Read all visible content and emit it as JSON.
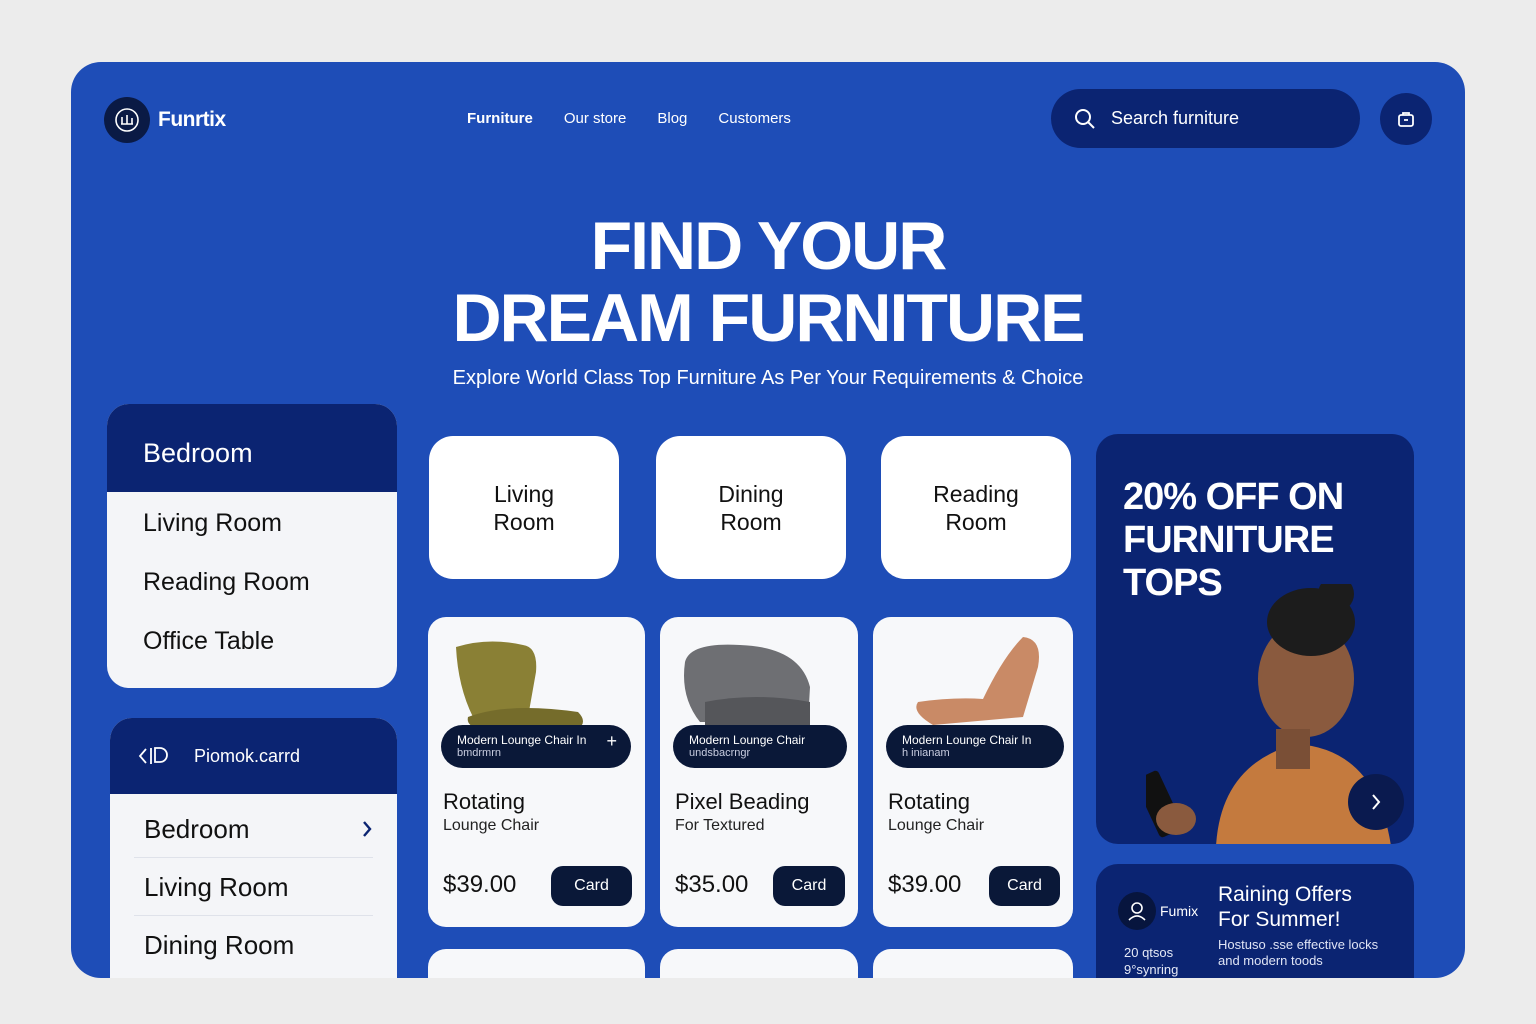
{
  "brand": {
    "name": "Funrtix"
  },
  "nav": [
    "Furniture",
    "Our store",
    "Blog",
    "Customers"
  ],
  "search": {
    "placeholder": "Search furniture"
  },
  "hero": {
    "title_line1": "FIND YOUR",
    "title_line2": "DREAM FURNITURE",
    "subtitle": "Explore World Class Top Furniture As Per Your Requirements & Choice"
  },
  "categories_primary": {
    "selected": "Bedroom",
    "items": [
      "Living Room",
      "Reading Room",
      "Office Table"
    ]
  },
  "categories_secondary": {
    "header": "Piomok.carrd",
    "items": [
      "Bedroom",
      "Living Room",
      "Dining Room"
    ]
  },
  "rooms": [
    "Living\nRoom",
    "Dining\nRoom",
    "Reading\nRoom"
  ],
  "products": [
    {
      "tag": "Modern Lounge Chair In",
      "tag_sub": "bmdrmrn",
      "name": "Rotating",
      "desc": "Lounge Chair",
      "price": "$39.00",
      "button": "Card",
      "color": "#8a8035"
    },
    {
      "tag": "Modern Lounge Chair",
      "tag_sub": "undsbacrngr",
      "name": "Pixel Beading",
      "desc": "For Textured",
      "price": "$35.00",
      "button": "Card",
      "color": "#6e6f73"
    },
    {
      "tag": "Modern Lounge Chair In",
      "tag_sub": "h inianam",
      "name": "Rotating",
      "desc": "Lounge Chair",
      "price": "$39.00",
      "button": "Card",
      "color": "#c98a66"
    }
  ],
  "promo": {
    "title": "20% OFF ON FURNITURE TOPS"
  },
  "summer": {
    "brand": "Fumix",
    "title": "Raining Offers For Summer!",
    "desc": "Hostuso .sse effective locks and modern toods",
    "stat1": "20 qtsos",
    "stat2": "9°synring"
  },
  "colors": {
    "background": "#1e4db7",
    "navy": "#0b2472",
    "dark": "#0a1838"
  },
  "icons": [
    "logo-icon",
    "search-icon",
    "cart-icon",
    "plus-icon",
    "chevron-right-icon",
    "user-icon",
    "card-icon"
  ]
}
